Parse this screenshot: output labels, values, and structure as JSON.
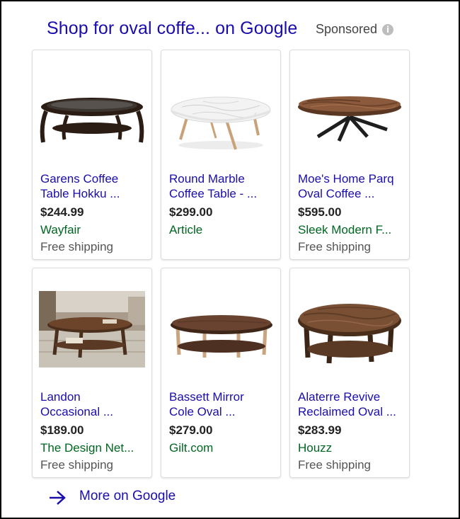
{
  "header": {
    "title": "Shop for oval coffe... on Google",
    "sponsored": "Sponsored",
    "info_glyph": "i"
  },
  "colors": {
    "link": "#1a0dab",
    "merchant": "#006621",
    "price": "#222222",
    "shipping": "#555555"
  },
  "products": [
    {
      "title_line1": "Garens Coffee",
      "title_line2": "Table Hokku ...",
      "price": "$244.99",
      "merchant": "Wayfair",
      "shipping": "Free shipping",
      "icon": "glass-top-coffee-table"
    },
    {
      "title_line1": "Round Marble",
      "title_line2": "Coffee Table - ...",
      "price": "$299.00",
      "merchant": "Article",
      "shipping": "",
      "icon": "marble-coffee-table"
    },
    {
      "title_line1": "Moe's Home Parq",
      "title_line2": "Oval Coffee ...",
      "price": "$595.00",
      "merchant": "Sleek Modern F...",
      "shipping": "Free shipping",
      "icon": "wood-slab-coffee-table"
    },
    {
      "title_line1": "Landon",
      "title_line2": "Occasional ...",
      "price": "$189.00",
      "merchant": "The Design Net...",
      "shipping": "Free shipping",
      "icon": "room-coffee-table-photo"
    },
    {
      "title_line1": "Bassett Mirror",
      "title_line2": "Cole Oval ...",
      "price": "$279.00",
      "merchant": "Gilt.com",
      "shipping": "",
      "icon": "walnut-coffee-table"
    },
    {
      "title_line1": "Alaterre Revive",
      "title_line2": "Reclaimed Oval ...",
      "price": "$283.99",
      "merchant": "Houzz",
      "shipping": "Free shipping",
      "icon": "reclaimed-wood-coffee-table"
    }
  ],
  "more_link": {
    "label": "More on Google",
    "icon": "arrow-right-icon"
  }
}
